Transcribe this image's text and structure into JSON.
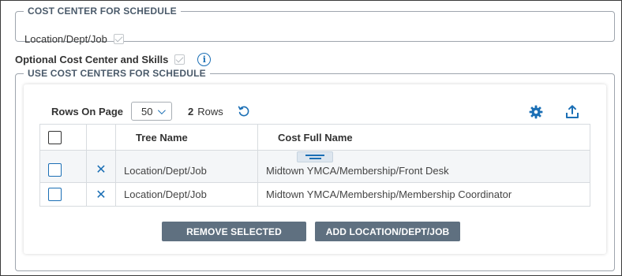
{
  "cost_center_section": {
    "legend": "COST CENTER FOR SCHEDULE",
    "checkbox_label": "Location/Dept/Job",
    "checked": true,
    "disabled": true
  },
  "optional_section": {
    "label": "Optional Cost Center and Skills",
    "checked": true,
    "disabled": true,
    "info_icon": "info-icon"
  },
  "use_cost_centers_section": {
    "legend": "USE COST CENTERS FOR SCHEDULE",
    "toolbar": {
      "rows_on_page_label": "Rows On Page",
      "rows_per_page_value": "50",
      "row_count": "2",
      "row_count_suffix": "Rows",
      "refresh_icon": "refresh-icon",
      "settings_icon": "gear-icon",
      "export_icon": "export-icon"
    },
    "grid": {
      "columns": [
        "",
        "",
        "Tree Name",
        "Cost Full Name"
      ],
      "rows": [
        {
          "remove_glyph": "✕",
          "tree_name": "Location/Dept/Job",
          "cost_full_name": "Midtown YMCA/Membership/Front Desk"
        },
        {
          "remove_glyph": "✕",
          "tree_name": "Location/Dept/Job",
          "cost_full_name": "Midtown YMCA/Membership/Membership Coordinator"
        }
      ]
    },
    "buttons": {
      "remove_selected": "REMOVE SELECTED",
      "add_location": "ADD LOCATION/DEPT/JOB"
    }
  },
  "colors": {
    "accent_blue": "#1b6fb5",
    "button_gray": "#5f7080",
    "legend_text": "#4a5a6a"
  }
}
